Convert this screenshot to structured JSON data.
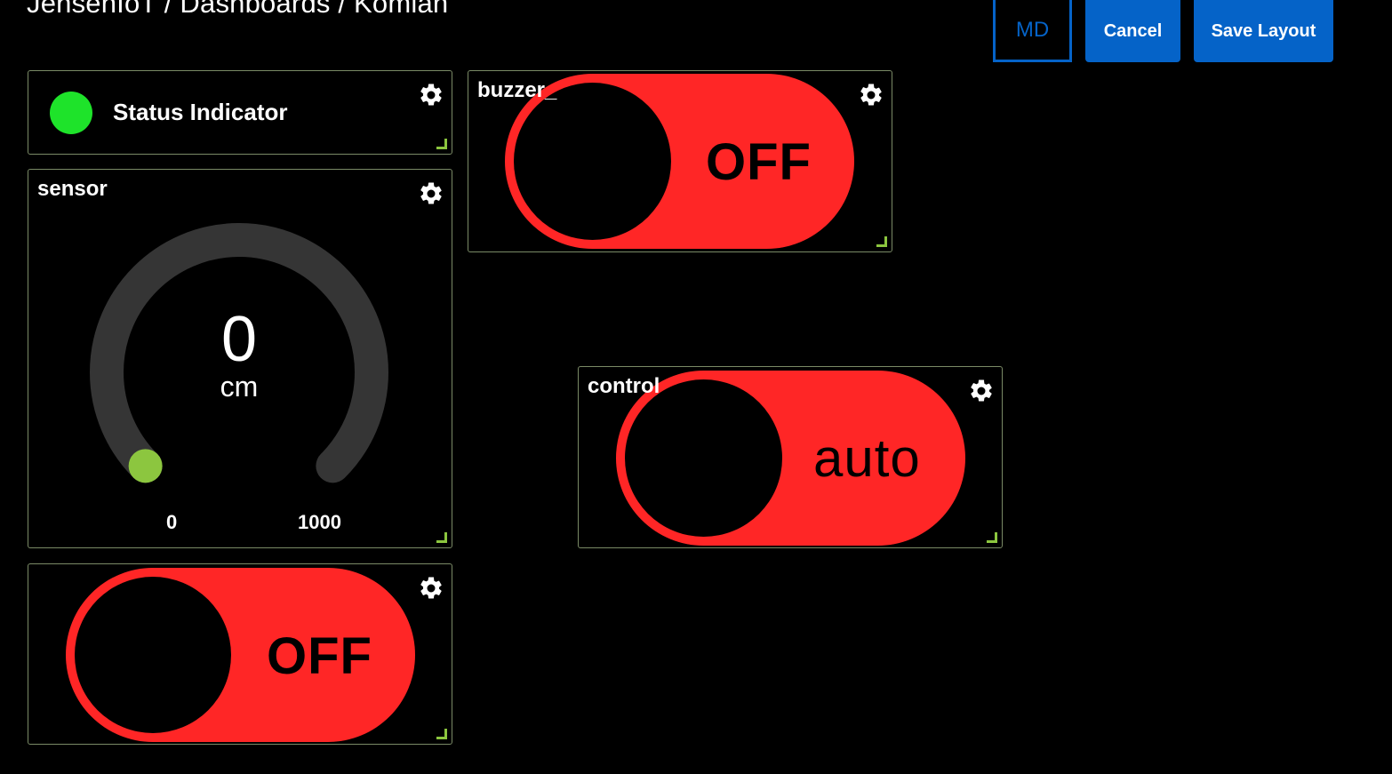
{
  "header": {
    "breadcrumb": "JensenIoT / Dashboards / Komlan",
    "buttons": {
      "md": "MD",
      "cancel": "Cancel",
      "save": "Save Layout"
    },
    "accent": "#0563c8"
  },
  "widgets": {
    "status": {
      "label": "Status Indicator",
      "color": "#1ee32a",
      "icon": "gear-icon"
    },
    "buzzer": {
      "title": "buzzer_",
      "state": "OFF",
      "color": "#ff2626"
    },
    "sensor": {
      "title": "sensor",
      "value": "0",
      "unit": "cm",
      "min": "0",
      "max": "1000",
      "fraction": 0,
      "indicator_color": "#8cc63f"
    },
    "control": {
      "title": "control",
      "state": "auto",
      "color": "#ff2626"
    },
    "switch": {
      "state": "OFF",
      "color": "#ff2626"
    }
  }
}
